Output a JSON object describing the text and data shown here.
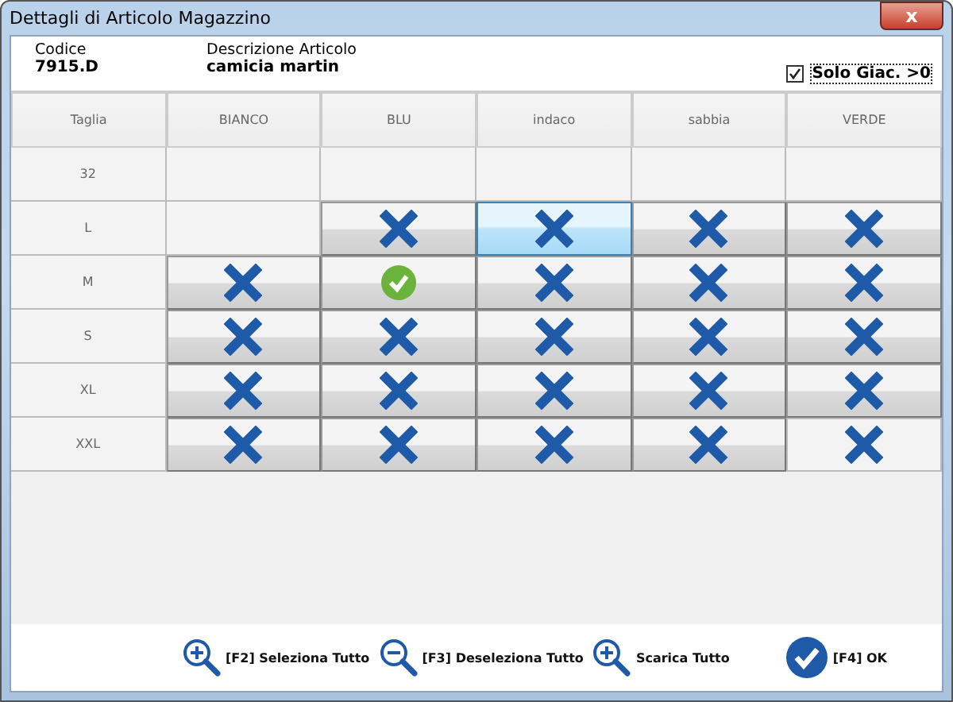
{
  "window": {
    "title": "Dettagli di Articolo Magazzino",
    "close": "x"
  },
  "header": {
    "code_label": "Codice",
    "code": "7915.D",
    "desc_label": "Descrizione Articolo",
    "desc": "camicia martin",
    "filter": {
      "label": "Solo Giac. >0",
      "checked": true
    }
  },
  "grid": {
    "corner": "Taglia",
    "columns": [
      "BIANCO",
      "BLU",
      "indaco",
      "sabbia",
      "VERDE"
    ],
    "rows": [
      {
        "size": "32",
        "cells": [
          {
            "kind": "empty",
            "selected": false
          },
          {
            "kind": "empty",
            "selected": false
          },
          {
            "kind": "empty",
            "selected": false
          },
          {
            "kind": "empty",
            "selected": false
          },
          {
            "kind": "empty",
            "selected": false
          }
        ]
      },
      {
        "size": "L",
        "cells": [
          {
            "kind": "empty",
            "selected": false
          },
          {
            "kind": "cross",
            "selected": false
          },
          {
            "kind": "cross",
            "selected": true
          },
          {
            "kind": "cross",
            "selected": false
          },
          {
            "kind": "cross",
            "selected": false
          }
        ]
      },
      {
        "size": "M",
        "cells": [
          {
            "kind": "cross",
            "selected": false
          },
          {
            "kind": "check",
            "selected": false
          },
          {
            "kind": "cross",
            "selected": false
          },
          {
            "kind": "cross",
            "selected": false
          },
          {
            "kind": "cross",
            "selected": false
          }
        ]
      },
      {
        "size": "S",
        "cells": [
          {
            "kind": "cross",
            "selected": false
          },
          {
            "kind": "cross",
            "selected": false
          },
          {
            "kind": "cross",
            "selected": false
          },
          {
            "kind": "cross",
            "selected": false
          },
          {
            "kind": "cross",
            "selected": false
          }
        ]
      },
      {
        "size": "XL",
        "cells": [
          {
            "kind": "cross",
            "selected": false
          },
          {
            "kind": "cross",
            "selected": false
          },
          {
            "kind": "cross",
            "selected": false
          },
          {
            "kind": "cross",
            "selected": false
          },
          {
            "kind": "cross",
            "selected": false
          }
        ]
      },
      {
        "size": "XXL",
        "cells": [
          {
            "kind": "cross",
            "selected": false
          },
          {
            "kind": "cross",
            "selected": false
          },
          {
            "kind": "cross",
            "selected": false
          },
          {
            "kind": "cross",
            "selected": false
          },
          {
            "kind": "cross-flat",
            "selected": false
          }
        ]
      }
    ]
  },
  "buttons": [
    {
      "label": "[F2] Seleziona Tutto",
      "kind": "zoom-in"
    },
    {
      "label": "[F3] Deseleziona Tutto",
      "kind": "zoom-out"
    },
    {
      "label": "Scarica Tutto",
      "kind": "zoom-in"
    },
    {
      "label": "[F4] OK",
      "kind": "ok"
    }
  ]
}
